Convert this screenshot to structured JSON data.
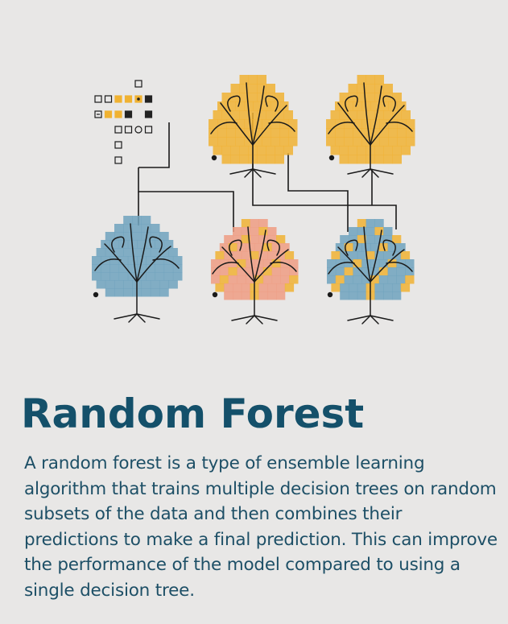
{
  "title": "Random Forest",
  "description": "A random forest is a type of ensemble learning algorithm that trains multiple decision trees on random subsets of the data and then combines their predictions to make a final prediction. This can improve the performance of the model compared to using a single decision tree.",
  "colors": {
    "background": "#e8e7e6",
    "title": "#14506a",
    "text": "#1d4f66",
    "line": "#1a1a1a",
    "orange": "#f0b232",
    "blue": "#6fa2bd",
    "salmon": "#ef9c83",
    "pixel_dark": "#222222"
  },
  "trees": [
    {
      "id": "tree-top-left",
      "palette": [
        "orange"
      ]
    },
    {
      "id": "tree-top-right",
      "palette": [
        "orange"
      ]
    },
    {
      "id": "tree-bottom-left",
      "palette": [
        "blue"
      ]
    },
    {
      "id": "tree-bottom-center",
      "palette": [
        "salmon",
        "orange"
      ]
    },
    {
      "id": "tree-bottom-right",
      "palette": [
        "blue",
        "orange"
      ]
    }
  ],
  "pixel_grid": [
    [
      "",
      "",
      "",
      "",
      "outline",
      ""
    ],
    [
      "outline",
      "outline",
      "orange",
      "orange",
      "orange-dot",
      "dark"
    ],
    [
      "outline-x",
      "orange",
      "orange",
      "dark",
      "",
      "dark"
    ],
    [
      "",
      "",
      "outline",
      "outline",
      "circle",
      "outline"
    ],
    [
      "",
      "",
      "outline",
      "",
      "",
      ""
    ],
    [
      "",
      "",
      "outline",
      "",
      "",
      ""
    ]
  ]
}
